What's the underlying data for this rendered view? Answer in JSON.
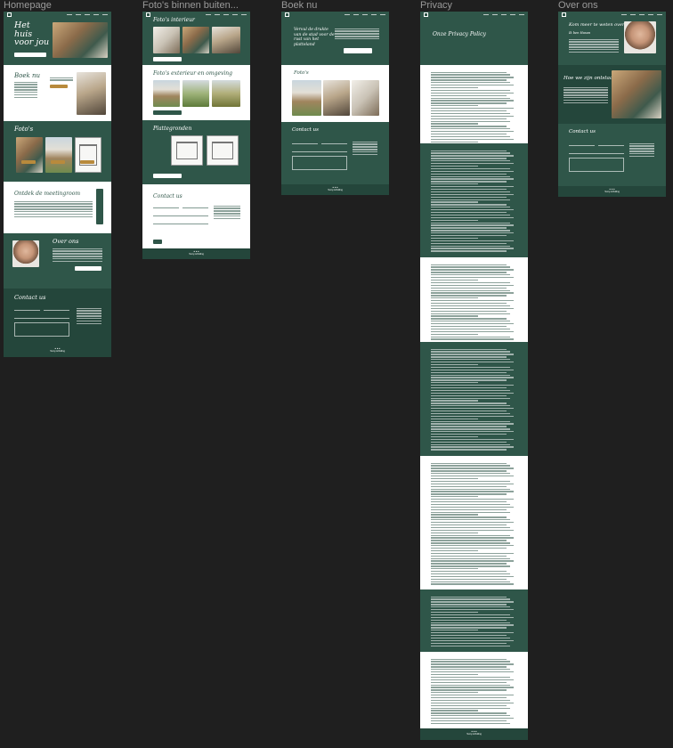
{
  "canvas": {
    "background": "#1f1f1f",
    "accent": "#2f5649",
    "gold": "#b88a3c"
  },
  "frames": {
    "homepage": {
      "label": "Homepage",
      "hero_title": "Het huis voor jou",
      "book_title": "Boek nu",
      "photos_title": "Foto's",
      "meeting_title": "Ontdek de meetingroom",
      "about_title": "Over ons",
      "contact_title": "Contact us",
      "footer_brand": "Tenny & Rolling"
    },
    "photos": {
      "label": "Foto's binnen buiten...",
      "interior_title": "Foto's interieur",
      "exterior_title": "Foto's exterieur en omgeving",
      "plans_title": "Plattegronden",
      "contact_title": "Contact us",
      "footer_brand": "Tenny & Rolling"
    },
    "book": {
      "label": "Boek nu",
      "hero_title": "Vervul de drukte van de stad voor de rust van het platteland",
      "photos_title": "Foto's",
      "contact_title": "Contact us",
      "footer_brand": "Tenny & Rolling"
    },
    "privacy": {
      "label": "Privacy",
      "title": "Onze Privacy Policy",
      "footer_brand": "Tenny & Rolling"
    },
    "about": {
      "label": "Over ons",
      "title": "Kom meer te weten over ons",
      "name": "Ik ben Hasan",
      "work_title": "Hoe we zijn ontstaan",
      "contact_title": "Contact us",
      "footer_brand": "Tenny & Rolling"
    }
  }
}
